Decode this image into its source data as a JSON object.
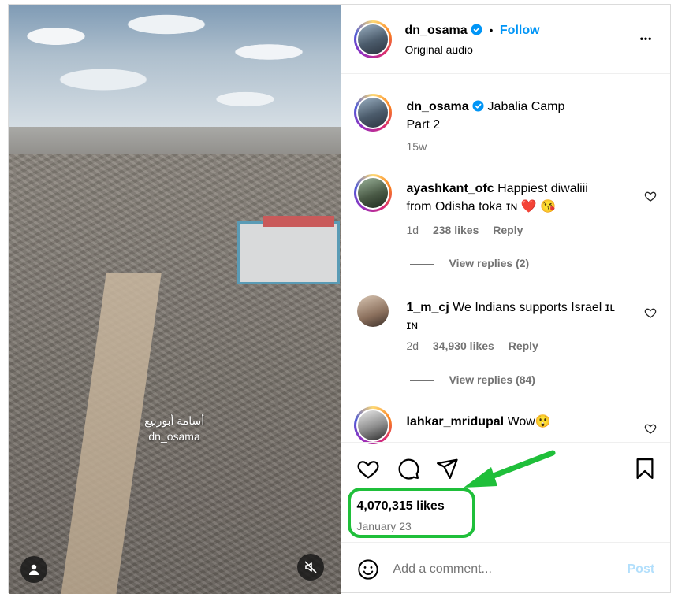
{
  "post": {
    "username": "dn_osama",
    "follow_label": "Follow",
    "dot": "•",
    "audio": "Original audio",
    "more_label": "•••"
  },
  "caption": {
    "username": "dn_osama",
    "text_line1": "Jabalia Camp",
    "text_line2": "Part 2",
    "time": "15w"
  },
  "comments": [
    {
      "username": "ayashkant_ofc",
      "text_line1": "Happiest diwaliii",
      "text_line2": "from Odisha toka ɪɴ ❤️ 😘",
      "time": "1d",
      "likes": "238 likes",
      "reply": "Reply",
      "view_replies": "View replies (2)"
    },
    {
      "username": "1_m_cj",
      "text_line1": "We Indians supports Israel ɪʟ",
      "text_line2": "ɪɴ",
      "time": "2d",
      "likes": "34,930 likes",
      "reply": "Reply",
      "view_replies": "View replies (84)"
    },
    {
      "username": "lahkar_mridupal",
      "text_line1": "Wow😲"
    }
  ],
  "media": {
    "overlay_line1": "أسامة أبوربيع",
    "overlay_line2": "dn_osama"
  },
  "stats": {
    "likes": "4,070,315 likes",
    "date": "January 23"
  },
  "compose": {
    "placeholder": "Add a comment...",
    "post_label": "Post"
  },
  "colors": {
    "follow": "#0095f6",
    "highlight": "#1fbf3a",
    "post_disabled": "#b2dffc"
  }
}
